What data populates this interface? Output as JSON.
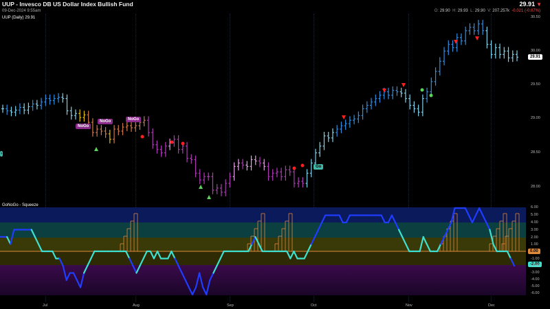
{
  "header": {
    "title": "UUP - Invesco DB US Dollar Index Bullish Fund",
    "date": "09-Dec-2024 9:55am",
    "last_price": "29.91",
    "ohlc": {
      "o_label": "O:",
      "o": "29.90",
      "h_label": "H:",
      "h": "29.93",
      "l_label": "L:",
      "l": "29.90",
      "v_label": "V:",
      "v": "207.257k",
      "chg": "-0.021 (-0.07%)"
    }
  },
  "price_pane": {
    "label": "UUP (Daily) 29.91",
    "price_badge": "29.91",
    "yticks": [
      "30.50",
      "30.00",
      "29.50",
      "29.00",
      "28.50",
      "28.00"
    ],
    "nogo_labels": [
      "NoGo",
      "NoGo",
      "NoGo"
    ],
    "go_label": "Go"
  },
  "oscillator_pane": {
    "label": "GoNoGo - Squeeze",
    "yticks": [
      "6.00",
      "5.00",
      "4.00",
      "3.00",
      "2.00",
      "1.00",
      "-1.00",
      "-2.00",
      "-3.00",
      "-4.00",
      "-5.00",
      "-6.00"
    ],
    "zero_badge": "0.00",
    "value_badge": "-2.00"
  },
  "x_axis": {
    "labels": [
      "Jul",
      "Aug",
      "Sep",
      "Oct",
      "Nov",
      "Dec"
    ]
  },
  "colors": {
    "go_strong": "#2f8fe6",
    "go_weak": "#7fd3ec",
    "nogo_strong": "#b03ab8",
    "nogo_weak": "#e0a4e3",
    "neutral": "#e8c000",
    "green_marker": "#5cd35c",
    "red_marker": "#ff2020",
    "osc_strong": "#1f3cff",
    "osc_weak": "#3fe0cf",
    "squeeze": "#e08a3c"
  },
  "chart_data": [
    {
      "type": "ohlc",
      "title": "UUP - Invesco DB US Dollar Index Bullish Fund",
      "ylim": [
        27.8,
        30.6
      ],
      "x_labels": [
        "Jul",
        "Aug",
        "Sep",
        "Oct",
        "Nov",
        "Dec"
      ],
      "closes": [
        29.15,
        29.12,
        29.1,
        29.13,
        29.17,
        29.13,
        29.18,
        29.22,
        29.2,
        29.25,
        29.3,
        29.27,
        29.3,
        29.32,
        29.3,
        29.12,
        29.05,
        29.08,
        29.02,
        29.06,
        28.95,
        28.8,
        28.85,
        28.82,
        28.78,
        28.7,
        28.85,
        28.82,
        28.88,
        28.9,
        28.87,
        28.9,
        28.95,
        28.98,
        28.8,
        28.62,
        28.55,
        28.5,
        28.6,
        28.65,
        28.7,
        28.55,
        28.6,
        28.42,
        28.4,
        28.2,
        28.1,
        28.15,
        28.15,
        27.95,
        27.98,
        27.92,
        28.05,
        28.15,
        28.3,
        28.35,
        28.32,
        28.3,
        28.4,
        28.38,
        28.35,
        28.3,
        28.15,
        28.2,
        28.22,
        28.15,
        28.25,
        28.22,
        28.05,
        28.08,
        28.05,
        28.2,
        28.35,
        28.5,
        28.6,
        28.75,
        28.72,
        28.8,
        28.85,
        28.9,
        28.93,
        28.98,
        29.0,
        29.05,
        29.15,
        29.2,
        29.25,
        29.3,
        29.35,
        29.4,
        29.35,
        29.42,
        29.4,
        29.38,
        29.3,
        29.2,
        29.15,
        29.1,
        29.3,
        29.4,
        29.55,
        29.7,
        29.85,
        30.0,
        30.1,
        30.05,
        30.2,
        30.15,
        30.3,
        30.35,
        30.3,
        30.4,
        30.3,
        30.1,
        29.95,
        30.05,
        29.95,
        30.0,
        29.9,
        29.95,
        29.91
      ],
      "colors": [
        "gw",
        "gs",
        "gw",
        "gw",
        "gs",
        "gw",
        "gw",
        "gs",
        "gw",
        "gs",
        "gs",
        "gs",
        "gs",
        "gs",
        "gw",
        "gw",
        "gw",
        "gw",
        "y",
        "y",
        "no",
        "no",
        "no",
        "no",
        "no",
        "y",
        "no",
        "no",
        "no",
        "no",
        "no",
        "no",
        "no",
        "no",
        "ns",
        "ns",
        "ns",
        "ns",
        "ns",
        "nw",
        "ns",
        "ns",
        "ns",
        "ns",
        "ns",
        "ns",
        "ns",
        "ns",
        "ns",
        "ns",
        "ns",
        "ns",
        "ns",
        "ns",
        "nw",
        "nw",
        "ns",
        "nw",
        "nw",
        "nw",
        "ns",
        "nw",
        "ns",
        "ns",
        "ns",
        "ns",
        "ns",
        "ns",
        "ns",
        "ns",
        "ns",
        "gw",
        "gw",
        "gw",
        "gw",
        "gw",
        "gw",
        "gw",
        "gs",
        "gs",
        "gs",
        "gs",
        "gs",
        "gs",
        "gs",
        "gs",
        "gs",
        "gs",
        "gs",
        "gs",
        "gs",
        "gs",
        "gs",
        "gw",
        "gw",
        "gw",
        "gw",
        "gw",
        "gw",
        "gs",
        "gs",
        "gs",
        "gs",
        "gs",
        "gs",
        "gs",
        "gs",
        "gs",
        "gs",
        "gs",
        "gs",
        "gs",
        "gs",
        "gw",
        "gw",
        "gw",
        "gw",
        "gw",
        "gw",
        "gw",
        "gw"
      ]
    },
    {
      "type": "line",
      "title": "GoNoGo - Squeeze",
      "ylim": [
        -6.5,
        6.5
      ],
      "series": [
        {
          "values": [
            2,
            2,
            2,
            1,
            3,
            3,
            3,
            3,
            3,
            3,
            2,
            1,
            0,
            0,
            0,
            0,
            -1,
            -1,
            -2,
            -4,
            -3,
            -3,
            -4,
            -5,
            -3,
            -2,
            -1,
            0,
            0,
            0,
            0,
            0,
            0,
            0,
            0,
            0,
            0,
            -1,
            -2,
            -3,
            -2,
            -1,
            0,
            0,
            -1,
            0,
            -1,
            -1,
            -1,
            0,
            -1,
            -2,
            -3,
            -4,
            -5,
            -6,
            -5,
            -3,
            -5,
            -6,
            -4,
            -3,
            -2,
            -1,
            0,
            0,
            0,
            0,
            0,
            0,
            0,
            0,
            1,
            2,
            1,
            0,
            0,
            0,
            0,
            0,
            0,
            0,
            0,
            -1,
            0,
            -1,
            -1,
            -1,
            0,
            1,
            2,
            3,
            4,
            5,
            5,
            5,
            5,
            5,
            4,
            4,
            5,
            5,
            5,
            5,
            5,
            5,
            5,
            5,
            5,
            5,
            4,
            4,
            5,
            4,
            3,
            2,
            1,
            0,
            0,
            0,
            0,
            2,
            1,
            0,
            0,
            0,
            1,
            2,
            3,
            4,
            6,
            6,
            6,
            6,
            5,
            4,
            5,
            6,
            5,
            4,
            3,
            1,
            0,
            0,
            0,
            0,
            -1,
            -2
          ]
        }
      ]
    }
  ]
}
